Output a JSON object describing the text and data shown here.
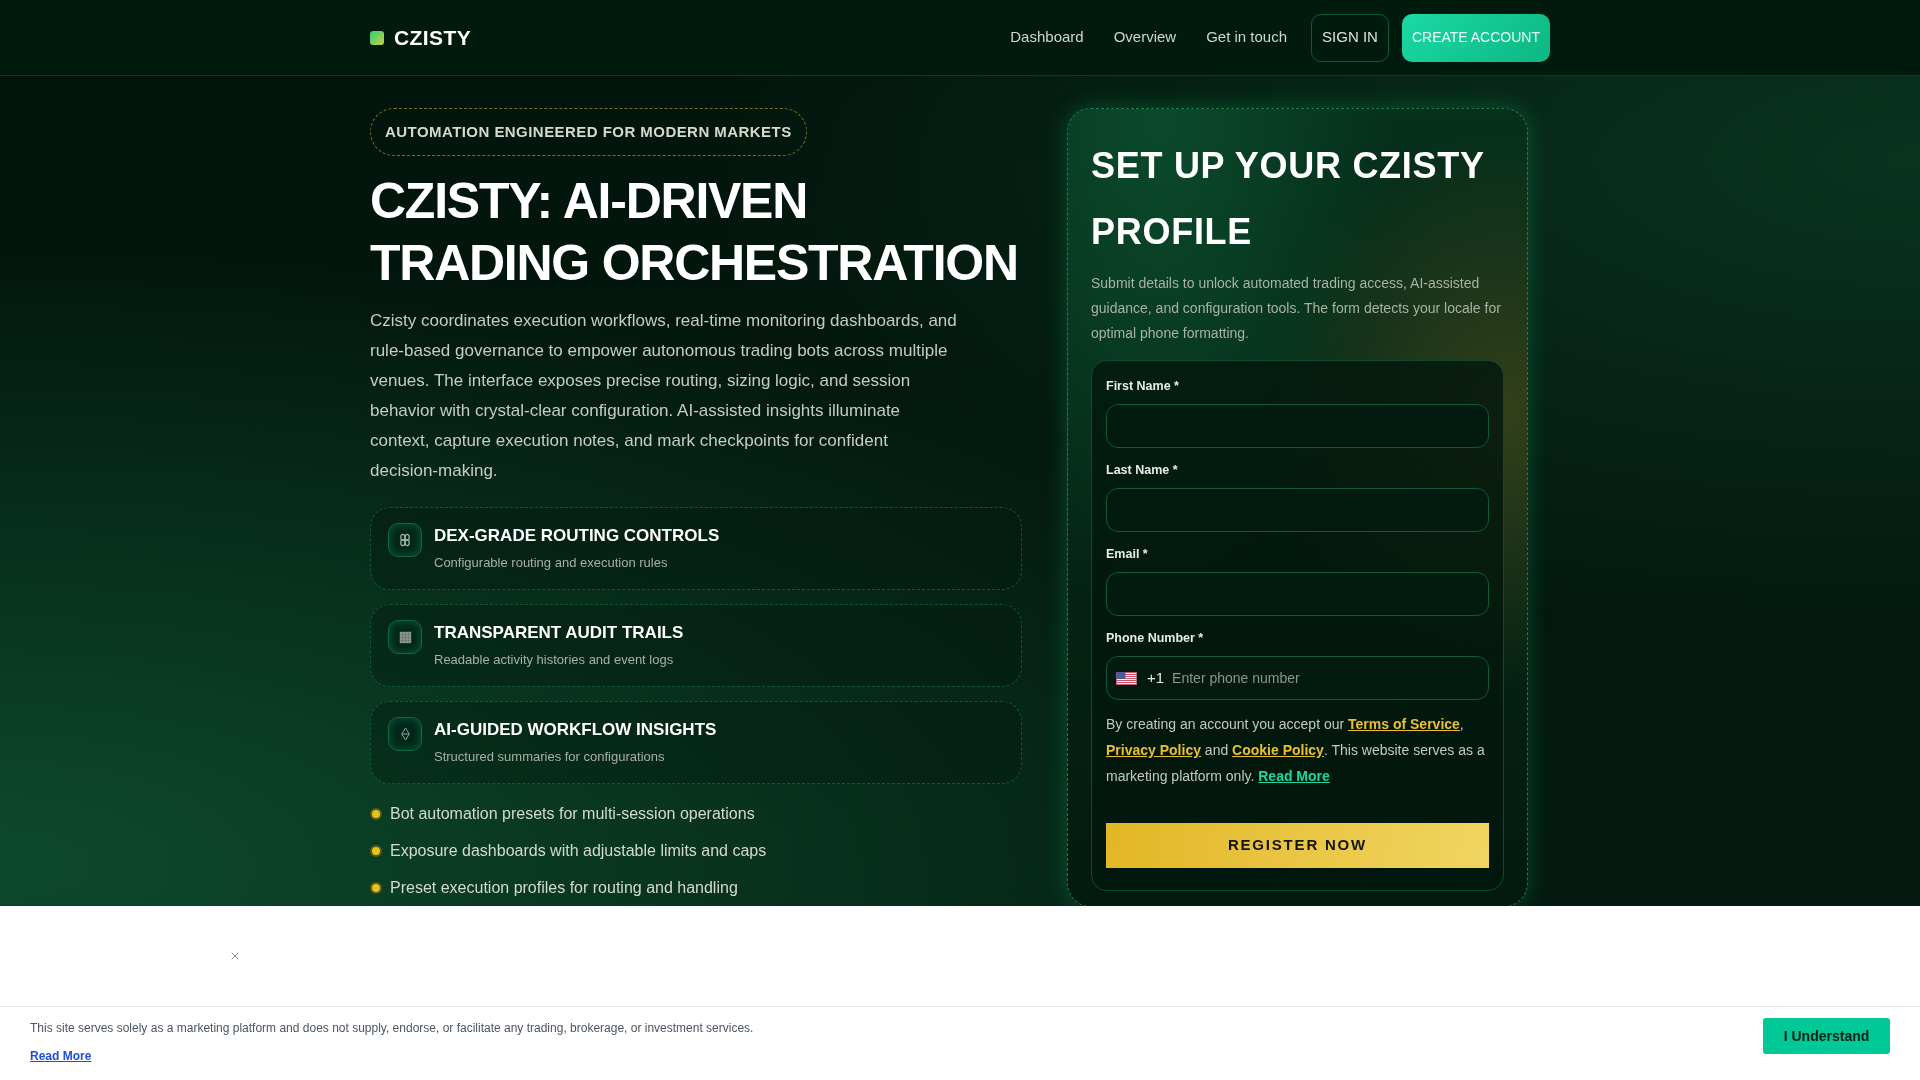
{
  "header": {
    "logo": "CZISTY",
    "nav": [
      "Dashboard",
      "Overview",
      "Get in touch"
    ],
    "sign_in": "SIGN IN",
    "create_account": "CREATE ACCOUNT"
  },
  "hero": {
    "badge": "AUTOMATION ENGINEERED FOR MODERN MARKETS",
    "title": "CZISTY: AI-DRIVEN TRADING ORCHESTRATION",
    "description": "Czisty coordinates execution workflows, real-time monitoring dashboards, and rule-based governance to empower autonomous trading bots across multiple venues. The interface exposes precise routing, sizing logic, and session behavior with crystal-clear configuration. AI-assisted insights illuminate context, capture execution notes, and mark checkpoints for confident decision-making.",
    "features": [
      {
        "title": "DEX-GRADE ROUTING CONTROLS",
        "subtitle": "Configurable routing and execution rules"
      },
      {
        "title": "TRANSPARENT AUDIT TRAILS",
        "subtitle": "Readable activity histories and event logs"
      },
      {
        "title": "AI-GUIDED WORKFLOW INSIGHTS",
        "subtitle": "Structured summaries for configurations"
      }
    ],
    "bullets": [
      "Bot automation presets for multi-session operations",
      "Exposure dashboards with adjustable limits and caps",
      "Preset execution profiles for routing and handling"
    ]
  },
  "form": {
    "title": "SET UP YOUR CZISTY PROFILE",
    "description": "Submit details to unlock automated trading access, AI-assisted guidance, and configuration tools. The form detects your locale for optimal phone formatting.",
    "fields": [
      {
        "kind": "text",
        "label": "First Name *"
      },
      {
        "kind": "text",
        "label": "Last Name *"
      },
      {
        "kind": "text",
        "label": "Email *"
      },
      {
        "kind": "phone",
        "label": "Phone Number *",
        "dial_code": "+1",
        "placeholder": "Enter phone number"
      }
    ],
    "consent": [
      {
        "kind": "text",
        "text": "By creating an account you accept our "
      },
      {
        "kind": "policy_link",
        "text": "Terms of Service"
      },
      {
        "kind": "text",
        "text": ", "
      },
      {
        "kind": "policy_link",
        "text": "Privacy Policy"
      },
      {
        "kind": "text",
        "text": " and "
      },
      {
        "kind": "policy_link",
        "text": "Cookie Policy"
      },
      {
        "kind": "text",
        "text": ". This website serves as a marketing platform only. "
      },
      {
        "kind": "more_link",
        "text": "Read More"
      }
    ],
    "submit": "REGISTER NOW"
  },
  "cookie_notice": {
    "text": "This site serves solely as a marketing platform and does not supply, endorse, or facilitate any trading, brokerage, or investment services.",
    "link": "Read More",
    "button": "I Understand"
  }
}
